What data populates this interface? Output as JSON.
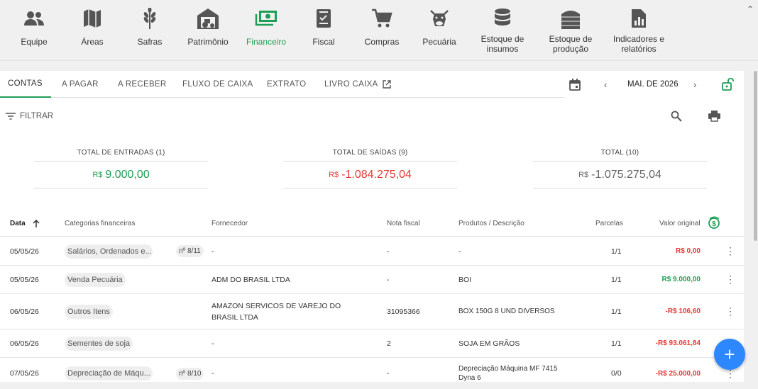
{
  "nav": {
    "items": [
      {
        "label": "Equipe",
        "icon": "team-icon"
      },
      {
        "label": "Áreas",
        "icon": "map-icon"
      },
      {
        "label": "Safras",
        "icon": "wheat-icon"
      },
      {
        "label": "Patrimônio",
        "icon": "tractor-barn-icon"
      },
      {
        "label": "Financeiro",
        "icon": "cash-icon"
      },
      {
        "label": "Fiscal",
        "icon": "invoice-icon"
      },
      {
        "label": "Compras",
        "icon": "cart-icon"
      },
      {
        "label": "Pecuária",
        "icon": "cow-icon"
      },
      {
        "label": "Estoque de insumos",
        "icon": "database-icon"
      },
      {
        "label": "Estoque de produção",
        "icon": "silo-icon"
      },
      {
        "label": "Indicadores e relatórios",
        "icon": "report-icon"
      }
    ],
    "active_color": "#1f9d55"
  },
  "tabs": [
    "CONTAS",
    "A PAGAR",
    "A RECEBER",
    "FLUXO DE CAIXA",
    "EXTRATO",
    "LIVRO CAIXA"
  ],
  "period": "MAI. DE 2026",
  "filter_label": "FILTRAR",
  "summary": {
    "entradas": {
      "title": "TOTAL DE ENTRADAS (1)",
      "currency": "R$",
      "value": "9.000,00"
    },
    "saidas": {
      "title": "TOTAL DE SAÍDAS (9)",
      "currency": "R$",
      "value": "-1.084.275,04"
    },
    "total": {
      "title": "TOTAL (10)",
      "currency": "R$",
      "value": "-1.075.275,04"
    }
  },
  "table": {
    "headers": {
      "data": "Data",
      "categoria": "Categorias financeiras",
      "fornecedor": "Fornecedor",
      "nota": "Nota fiscal",
      "produtos": "Produtos / Descrição",
      "parcelas": "Parcelas",
      "valor": "Valor original"
    },
    "rows": [
      {
        "data": "05/05/26",
        "categoria": "Salários, Ordenados e...",
        "badge": "nº 8/11",
        "fornecedor": "-",
        "nota": "-",
        "produtos": "-",
        "parcelas": "1/1",
        "valor": "R$ 0,00",
        "tone": "red"
      },
      {
        "data": "05/05/26",
        "categoria": "Venda Pecuária",
        "badge": "",
        "fornecedor": "ADM DO BRASIL LTDA",
        "nota": "-",
        "produtos": "BOI",
        "parcelas": "1/1",
        "valor": "R$ 9.000,00",
        "tone": "green"
      },
      {
        "data": "06/05/26",
        "categoria": "Outros Itens",
        "badge": "",
        "fornecedor": "AMAZON SERVICOS DE VAREJO DO BRASIL LTDA",
        "nota": "31095366",
        "produtos": "BOX 150G 8 UND DIVERSOS",
        "parcelas": "1/1",
        "valor": "-R$ 106,60",
        "tone": "red"
      },
      {
        "data": "06/05/26",
        "categoria": "Sementes de soja",
        "badge": "",
        "fornecedor": "-",
        "nota": "2",
        "produtos": "SOJA EM GRÃOS",
        "parcelas": "1/1",
        "valor": "-R$ 93.061,84",
        "tone": "red"
      },
      {
        "data": "07/05/26",
        "categoria": "Depreciação de Máqu...",
        "badge": "nº 8/10",
        "fornecedor": "-",
        "nota": "-",
        "produtos": "Depreciação Máquina MF 7415 Dyna 6",
        "parcelas": "0/0",
        "valor": "-R$ 25.000,00",
        "tone": "red"
      }
    ]
  },
  "fab_label": "+"
}
